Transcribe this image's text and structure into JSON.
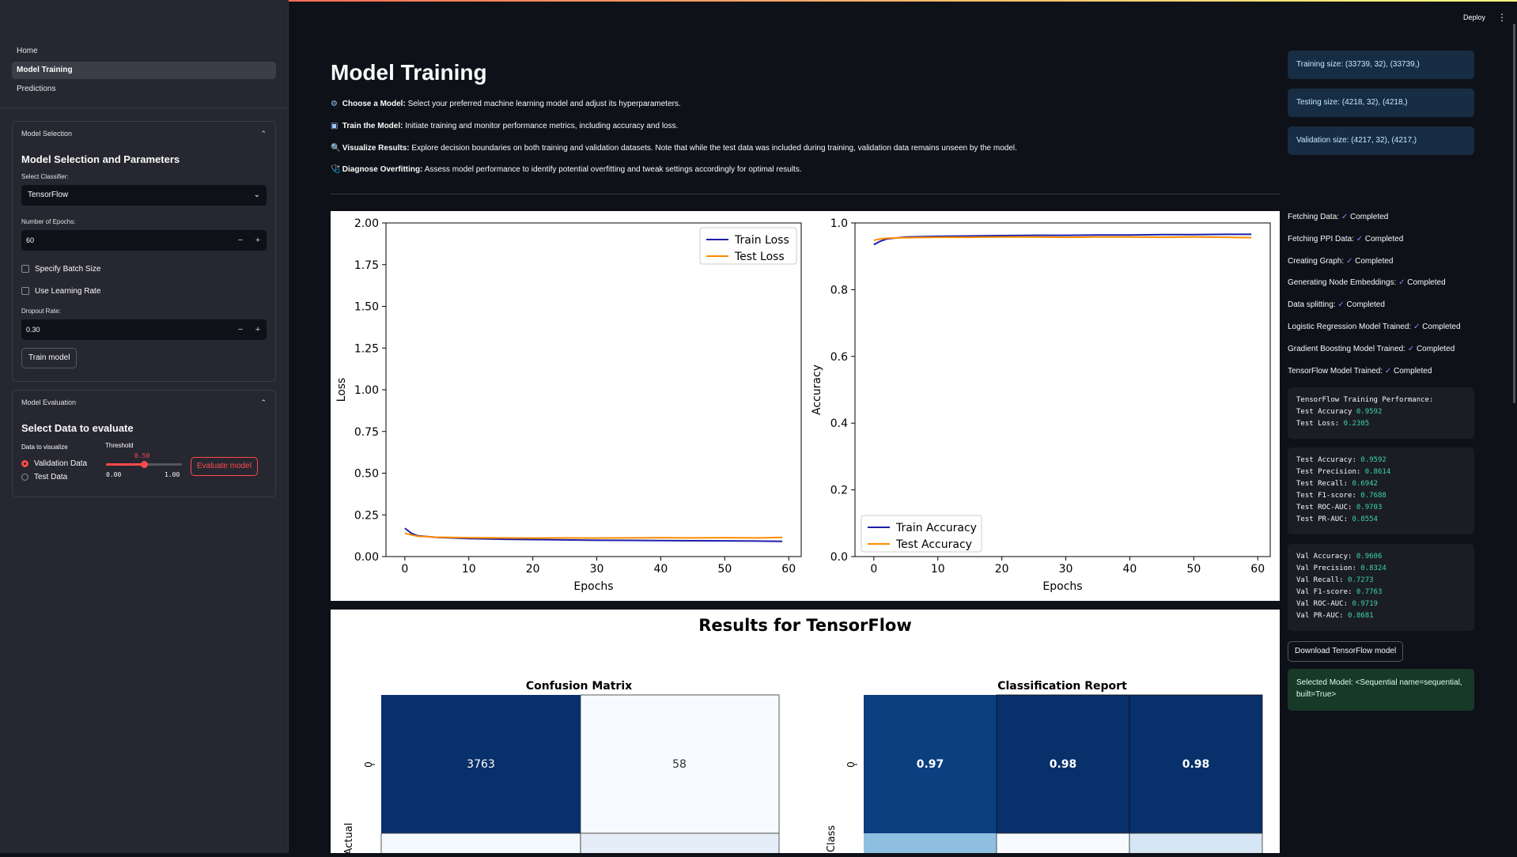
{
  "app": {
    "deploy_label": "Deploy",
    "menu_icon": "⋮"
  },
  "nav": {
    "items": [
      {
        "label": "Home"
      },
      {
        "label": "Model Training"
      },
      {
        "label": "Predictions"
      }
    ]
  },
  "model_selection": {
    "expander_label": "Model Selection",
    "title": "Model Selection and Parameters",
    "classifier_label": "Select Classifier:",
    "classifier_value": "TensorFlow",
    "epochs_label": "Number of Epochs:",
    "epochs_value": "60",
    "batch_size_label": "Specify Batch Size",
    "learning_rate_label": "Use Learning Rate",
    "dropout_label": "Dropout Rate:",
    "dropout_value": "0.30",
    "train_button": "Train model"
  },
  "model_evaluation": {
    "expander_label": "Model Evaluation",
    "title": "Select Data to evaluate",
    "data_label": "Data to visualize",
    "options": [
      "Validation Data",
      "Test Data"
    ],
    "selected": "Validation Data",
    "threshold_label": "Threshold",
    "threshold_value": "0.50",
    "threshold_min": "0.00",
    "threshold_max": "1.00",
    "evaluate_button": "Evaluate model"
  },
  "main": {
    "title": "Model Training",
    "steps": [
      {
        "icon": "⚙",
        "bold": "Choose a Model:",
        "text": " Select your preferred machine learning model and adjust its hyperparameters."
      },
      {
        "icon": "▣",
        "bold": "Train the Model:",
        "text": " Initiate training and monitor performance metrics, including accuracy and loss."
      },
      {
        "icon": "🔍",
        "bold": "Visualize Results:",
        "text": " Explore decision boundaries on both training and validation datasets. Note that while the test data was included during training, validation data remains unseen by the model."
      },
      {
        "icon": "🩺",
        "bold": "Diagnose Overfitting:",
        "text": " Assess model performance to identify potential overfitting and tweak settings accordingly for optimal results."
      }
    ],
    "results_title": "Results for TensorFlow"
  },
  "sizes": {
    "training": "Training size: (33739, 32), (33739,)",
    "testing": "Testing size: (4218, 32), (4218,)",
    "validation": "Validation size: (4217, 32), (4217,)"
  },
  "statuses": [
    {
      "label": "Fetching Data:",
      "value": "Completed"
    },
    {
      "label": "Fetching PPI Data:",
      "value": "Completed"
    },
    {
      "label": "Creating Graph:",
      "value": "Completed"
    },
    {
      "label": "Generating Node Embeddings:",
      "value": "Completed"
    },
    {
      "label": "Data splitting:",
      "value": "Completed"
    },
    {
      "label": "Logistic Regression Model Trained:",
      "value": "Completed"
    },
    {
      "label": "Gradient Boosting Model Trained:",
      "value": "Completed"
    },
    {
      "label": "TensorFlow Model Trained:",
      "value": "Completed"
    }
  ],
  "training_perf": {
    "title": "TensorFlow Training Performance:",
    "rows": [
      {
        "label": "Test Accuracy",
        "value": "0.9592"
      },
      {
        "label": "Test Loss:",
        "value": "0.2305"
      }
    ]
  },
  "test_metrics": [
    {
      "label": "Test Accuracy:",
      "value": "0.9592"
    },
    {
      "label": "Test Precision:",
      "value": "0.8614"
    },
    {
      "label": "Test Recall:",
      "value": "0.6942"
    },
    {
      "label": "Test F1-score:",
      "value": "0.7688"
    },
    {
      "label": "Test ROC-AUC:",
      "value": "0.9703"
    },
    {
      "label": "Test PR-AUC:",
      "value": "0.8554"
    }
  ],
  "val_metrics": [
    {
      "label": "Val Accuracy:",
      "value": "0.9606"
    },
    {
      "label": "Val Precision:",
      "value": "0.8324"
    },
    {
      "label": "Val Recall:",
      "value": "0.7273"
    },
    {
      "label": "Val F1-score:",
      "value": "0.7763"
    },
    {
      "label": "Val ROC-AUC:",
      "value": "0.9719"
    },
    {
      "label": "Val PR-AUC:",
      "value": "0.8681"
    }
  ],
  "download_button": "Download TensorFlow model",
  "selected_model": "Selected Model: <Sequential name=sequential, built=True>",
  "colors": {
    "accent": "#ff4b4b",
    "train_line": "#1f1fa8",
    "test_line": "#ff8c00",
    "info_bg": "#172d43",
    "success_bg": "#173928"
  },
  "chart_data": [
    {
      "type": "line",
      "xlabel": "Epochs",
      "ylabel": "Loss",
      "xlim": [
        -2.95,
        61.95
      ],
      "ylim": [
        0,
        2.0
      ],
      "xticks": [
        0,
        10,
        20,
        30,
        40,
        50,
        60
      ],
      "yticks": [
        0.0,
        0.25,
        0.5,
        0.75,
        1.0,
        1.25,
        1.5,
        1.75,
        2.0
      ],
      "legend": "top-right",
      "series": [
        {
          "name": "Train Loss",
          "color": "#1f1fa8",
          "x": [
            0,
            1,
            2,
            5,
            10,
            15,
            20,
            25,
            30,
            35,
            40,
            45,
            50,
            55,
            59
          ],
          "y": [
            0.17,
            0.14,
            0.125,
            0.115,
            0.108,
            0.104,
            0.102,
            0.1,
            0.098,
            0.097,
            0.096,
            0.095,
            0.094,
            0.093,
            0.091
          ]
        },
        {
          "name": "Test Loss",
          "color": "#ff8c00",
          "x": [
            0,
            1,
            2,
            5,
            10,
            15,
            20,
            25,
            30,
            35,
            40,
            45,
            50,
            55,
            59
          ],
          "y": [
            0.14,
            0.13,
            0.122,
            0.116,
            0.113,
            0.112,
            0.111,
            0.112,
            0.111,
            0.112,
            0.113,
            0.112,
            0.113,
            0.112,
            0.115
          ]
        }
      ]
    },
    {
      "type": "line",
      "xlabel": "Epochs",
      "ylabel": "Accuracy",
      "xlim": [
        -2.95,
        61.95
      ],
      "ylim": [
        0,
        1.0
      ],
      "xticks": [
        0,
        10,
        20,
        30,
        40,
        50,
        60
      ],
      "yticks": [
        0.0,
        0.2,
        0.4,
        0.6,
        0.8,
        1.0
      ],
      "legend": "bottom-left",
      "series": [
        {
          "name": "Train Accuracy",
          "color": "#1f1fa8",
          "x": [
            0,
            1,
            2,
            5,
            10,
            15,
            20,
            25,
            30,
            35,
            40,
            45,
            50,
            55,
            59
          ],
          "y": [
            0.935,
            0.945,
            0.952,
            0.958,
            0.96,
            0.961,
            0.962,
            0.963,
            0.963,
            0.964,
            0.964,
            0.965,
            0.965,
            0.966,
            0.966
          ]
        },
        {
          "name": "Test Accuracy",
          "color": "#ff8c00",
          "x": [
            0,
            1,
            2,
            5,
            10,
            15,
            20,
            25,
            30,
            35,
            40,
            45,
            50,
            55,
            59
          ],
          "y": [
            0.948,
            0.952,
            0.954,
            0.956,
            0.957,
            0.957,
            0.958,
            0.958,
            0.957,
            0.958,
            0.958,
            0.957,
            0.958,
            0.957,
            0.956
          ]
        }
      ]
    },
    {
      "type": "heatmap",
      "title": "Confusion Matrix",
      "ylabel": "Actual",
      "row_labels": [
        "0"
      ],
      "cells": [
        [
          3763,
          58
        ]
      ]
    },
    {
      "type": "heatmap",
      "title": "Classification Report",
      "ylabel": "Class",
      "row_labels": [
        "0"
      ],
      "cells": [
        [
          "0.97",
          "0.98",
          "0.98"
        ]
      ]
    }
  ]
}
